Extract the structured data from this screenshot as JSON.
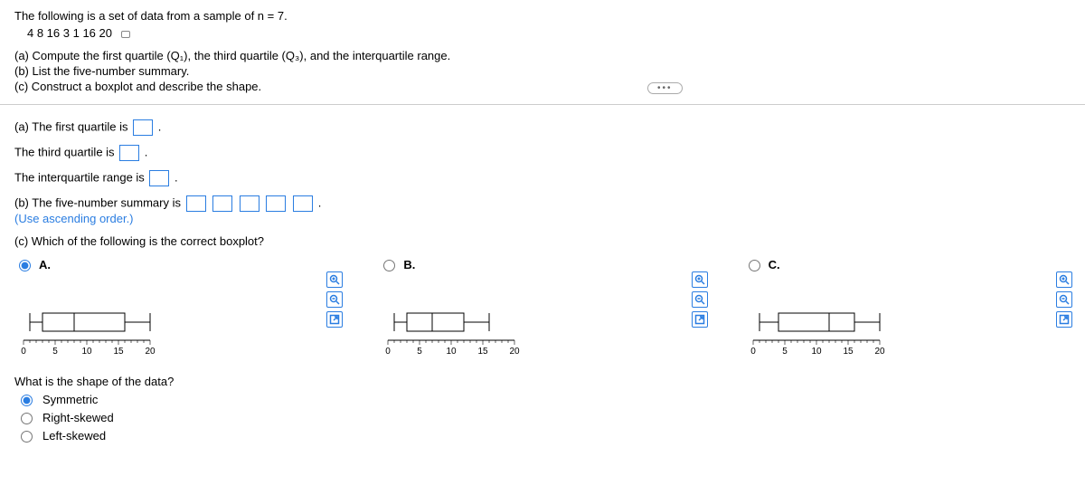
{
  "intro": "The following is a set of data from a sample of n = 7.",
  "data_values": "4  8  16  3  1  16  20",
  "tasks": {
    "a": "(a) Compute the first quartile (Q₁), the third quartile (Q₃), and the interquartile range.",
    "b": "(b) List the five-number summary.",
    "c": "(c) Construct a boxplot and describe the shape."
  },
  "answers": {
    "q1_label_before": "(a) The first quartile is ",
    "q3_label_before": "The third quartile is ",
    "iqr_label_before": "The interquartile range is ",
    "period": ".",
    "five_num_before": "(b) The five-number summary is ",
    "five_num_hint": "(Use ascending order.)",
    "boxplot_q": "(c) Which of the following is the correct boxplot?"
  },
  "choices": {
    "a": "A.",
    "b": "B.",
    "c": "C."
  },
  "axis_ticks": [
    "0",
    "5",
    "10",
    "15",
    "20"
  ],
  "shape": {
    "question": "What is the shape of the data?",
    "opts": [
      "Symmetric",
      "Right-skewed",
      "Left-skewed"
    ]
  },
  "icons": {
    "zoom_in": "zoom-in-icon",
    "zoom_out": "zoom-out-icon",
    "expand": "expand-icon"
  }
}
